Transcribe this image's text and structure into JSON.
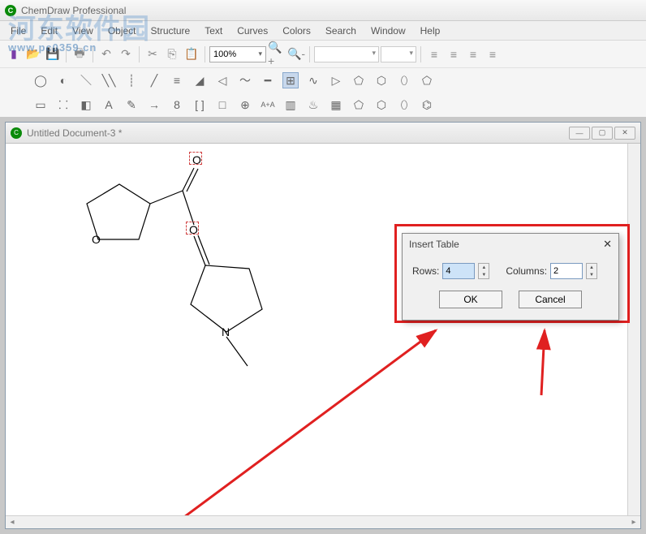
{
  "app": {
    "title": "ChemDraw Professional",
    "icon_glyph": "C"
  },
  "menu": [
    "File",
    "Edit",
    "View",
    "Object",
    "Structure",
    "Text",
    "Curves",
    "Colors",
    "Search",
    "Window",
    "Help"
  ],
  "toolbar": {
    "zoom_value": "100%",
    "zoom_in_tip": "Zoom In",
    "zoom_out_tip": "Zoom Out"
  },
  "document": {
    "title": "Untitled Document-3 *",
    "atoms": {
      "oxygen1": "O",
      "oxygen2": "O",
      "nitrogen": "N"
    }
  },
  "dialog": {
    "title": "Insert Table",
    "rows_label": "Rows:",
    "rows_value": "4",
    "cols_label": "Columns:",
    "cols_value": "2",
    "ok_label": "OK",
    "cancel_label": "Cancel"
  },
  "watermark": {
    "main": "河东软件园",
    "sub": "www.pc0359.cn"
  }
}
